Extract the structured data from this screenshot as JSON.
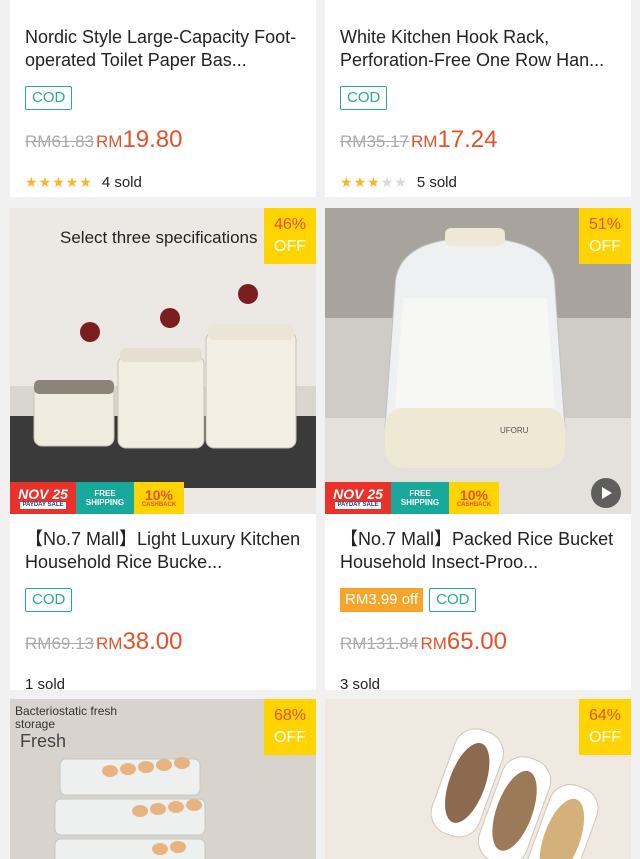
{
  "products": [
    {
      "title": "Nordic Style Large-Capacity Foot-operated Toilet Paper Bas...",
      "cod": "COD",
      "old_price": "RM61.83",
      "currency": "RM",
      "price": "19.80",
      "rating": 5,
      "sold": "4 sold"
    },
    {
      "title": "White Kitchen Hook Rack, Perforation-Free One Row Han...",
      "cod": "COD",
      "old_price": "RM35.17",
      "currency": "RM",
      "price": "17.24",
      "rating": 3,
      "sold": "5 sold"
    },
    {
      "image_text": "Select three specifications",
      "discount": "46%",
      "discount_off": "OFF",
      "title": "【No.7 Mall】Light Luxury Kitchen Household Rice Bucke...",
      "cod": "COD",
      "old_price": "RM69.13",
      "currency": "RM",
      "price": "38.00",
      "sold": "1 sold"
    },
    {
      "image_text": "UFORU",
      "discount": "51%",
      "discount_off": "OFF",
      "title": "【No.7 Mall】Packed Rice Bucket Household Insect-Proo...",
      "voucher": "RM3.99 off",
      "cod": "COD",
      "old_price": "RM131.84",
      "currency": "RM",
      "price": "65.00",
      "sold": "3 sold"
    },
    {
      "image_text_1": "Bacteriostatic fresh storage",
      "image_text_2": "Fresh",
      "discount": "68%",
      "discount_off": "OFF"
    },
    {
      "discount": "64%",
      "discount_off": "OFF"
    }
  ],
  "promo": {
    "nov": "NOV 25",
    "payday": "PAYDAY SALE",
    "ship_1": "FREE",
    "ship_2": "SHIPPING",
    "cash_1": "10%",
    "cash_2": "CASHBACK"
  },
  "colors": {
    "accent": "#e4522a",
    "cod": "#2aa69a",
    "discount_badge": "#ffd400",
    "star": "#f7b52a"
  }
}
